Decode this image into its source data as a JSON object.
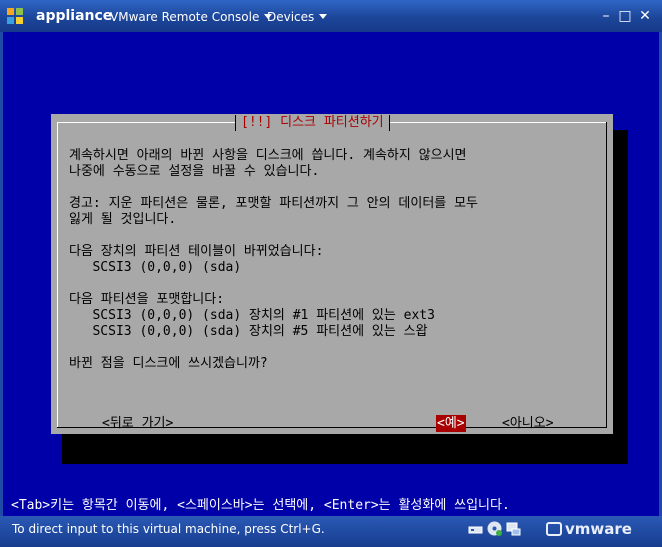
{
  "window": {
    "app_name": "appliance",
    "menus": [
      "VMware Remote Console",
      "Devices"
    ],
    "controls": {
      "minimize": "–",
      "maximize": "□",
      "close": "✕"
    }
  },
  "dialog": {
    "title": "[!!] 디스크 파티션하기",
    "text": "계속하시면 아래의 바뀐 사항을 디스크에 씁니다. 계속하지 않으시면\n나중에 수동으로 설정을 바꿀 수 있습니다.\n\n경고: 지운 파티션은 물론, 포맷할 파티션까지 그 안의 데이터를 모두\n잃게 될 것입니다.\n\n다음 장치의 파티션 테이블이 바뀌었습니다:\n   SCSI3 (0,0,0) (sda)\n\n다음 파티션을 포맷합니다:\n   SCSI3 (0,0,0) (sda) 장치의 #1 파티션에 있는 ext3\n   SCSI3 (0,0,0) (sda) 장치의 #5 파티션에 있는 스왑\n\n바뀐 점을 디스크에 쓰시겠습니까?",
    "buttons": {
      "back": "<뒤로 가기>",
      "yes": "<예>",
      "no": "<아니오>"
    }
  },
  "hint": "<Tab>키는 항목간 이동에, <스페이스바>는 선택에, <Enter>는 활성화에 쓰입니다.",
  "statusbar": {
    "text": "To direct input to this virtual machine, press Ctrl+G.",
    "brand": "vmware"
  },
  "colors": {
    "console_bg": "#0000a8",
    "dialog_bg": "#a8a8a8",
    "accent_red": "#a80000",
    "titlebar": "#1c4699"
  }
}
